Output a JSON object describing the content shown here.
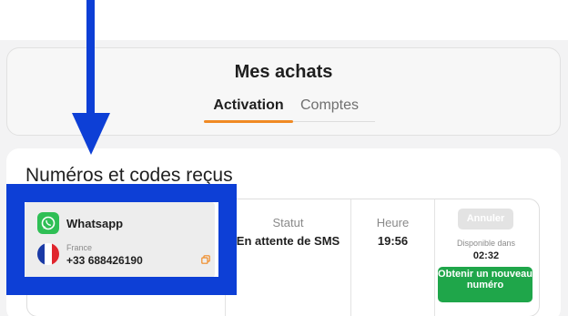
{
  "header": {
    "title": "Mes achats"
  },
  "tabs": [
    {
      "label": "Activation",
      "active": true
    },
    {
      "label": "Comptes",
      "active": false
    }
  ],
  "section": {
    "title": "Numéros et codes reçus"
  },
  "columns": {
    "status": "Statut",
    "time": "Heure"
  },
  "order": {
    "service": "Whatsapp",
    "service_icon": "whatsapp-icon",
    "country": "France",
    "flag_icon": "france-flag-icon",
    "phone": "+33 688426190",
    "status": "En attente de SMS",
    "time": "19:56",
    "availability_label": "Disponible dans",
    "countdown": "02:32",
    "cancel_label": "Annuler",
    "new_number_label": "Obtenir un nouveau numéro"
  },
  "colors": {
    "accent": "#f08a24",
    "highlight": "#0d3fd6",
    "whatsapp": "#2fbf55",
    "primary_button": "#1fa64a",
    "disabled_button": "#e3e3e3"
  }
}
